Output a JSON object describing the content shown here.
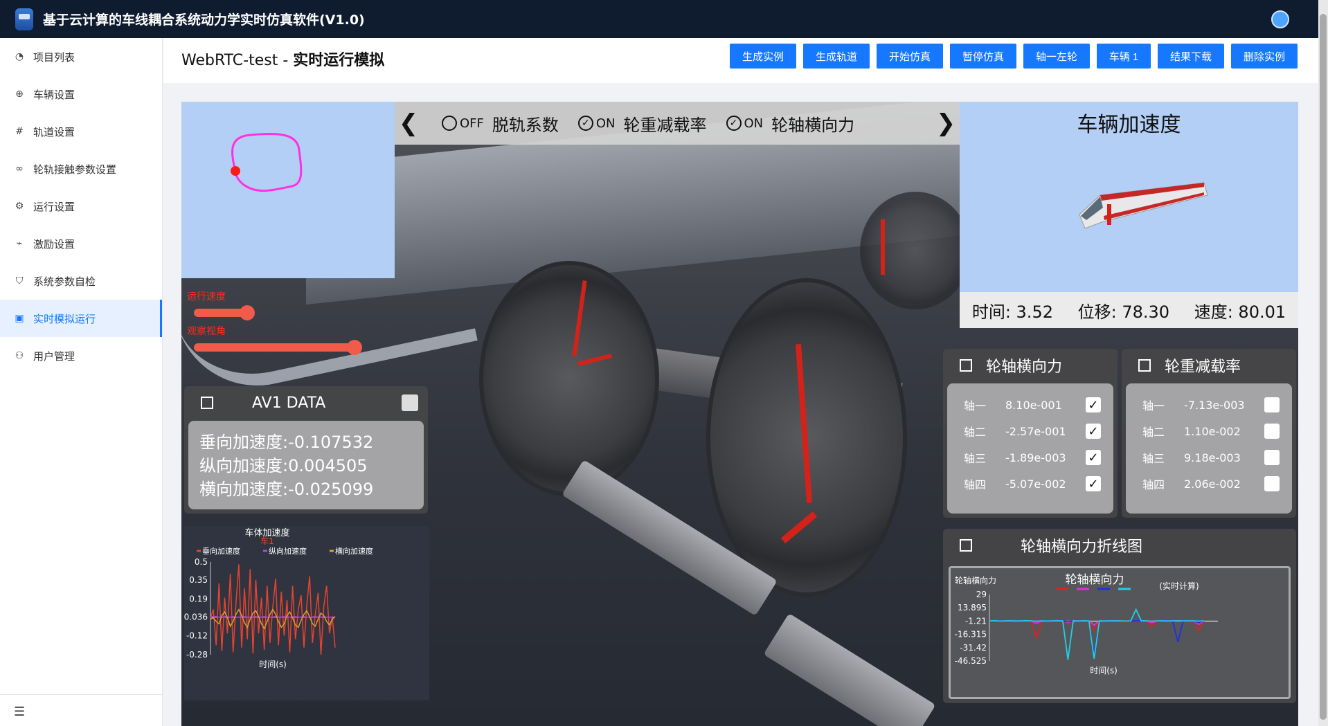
{
  "app": {
    "title": "基于云计算的车线耦合系统动力学实时仿真软件(V1.0)"
  },
  "sidebar": {
    "items": [
      {
        "label": "项目列表",
        "icon": "dashboard-icon"
      },
      {
        "label": "车辆设置",
        "icon": "globe-icon"
      },
      {
        "label": "轨道设置",
        "icon": "hash-icon"
      },
      {
        "label": "轮轨接触参数设置",
        "icon": "link-icon"
      },
      {
        "label": "运行设置",
        "icon": "gear-icon"
      },
      {
        "label": "激励设置",
        "icon": "line-chart-icon"
      },
      {
        "label": "系统参数自检",
        "icon": "shield-check-icon"
      },
      {
        "label": "实时模拟运行",
        "icon": "monitor-icon",
        "active": true
      },
      {
        "label": "用户管理",
        "icon": "user-icon"
      }
    ]
  },
  "header": {
    "project": "WebRTC-test - ",
    "page": "实时运行模拟",
    "buttons": [
      "生成实例",
      "生成轨道",
      "开始仿真",
      "暂停仿真",
      "轴一左轮",
      "车辆 1",
      "结果下载",
      "删除实例"
    ]
  },
  "toggles": [
    {
      "state": "OFF",
      "label": "脱轨系数",
      "checked": false
    },
    {
      "state": "ON",
      "label": "轮重减载率",
      "checked": true
    },
    {
      "state": "ON",
      "label": "轮轴横向力",
      "checked": true
    }
  ],
  "sliders": [
    {
      "label": "运行速度",
      "level": 0.33
    },
    {
      "label": "观察视角",
      "level": 1.0
    }
  ],
  "accel_panel": {
    "title": "车辆加速度"
  },
  "status": {
    "time_label": "时间: 3.52",
    "disp_label": "位移: 78.30",
    "speed_label": "速度: 80.01"
  },
  "av1": {
    "title": "AV1 DATA",
    "lines": [
      "垂向加速度:-0.107532",
      "纵向加速度:0.004505",
      "横向加速度:-0.025099"
    ]
  },
  "axle_force_panel": {
    "title": "轮轴横向力",
    "rows": [
      {
        "k": "轴一",
        "v": "8.10e-001",
        "checked": true
      },
      {
        "k": "轴二",
        "v": "-2.57e-001",
        "checked": true
      },
      {
        "k": "轴三",
        "v": "-1.89e-003",
        "checked": true
      },
      {
        "k": "轴四",
        "v": "-5.07e-002",
        "checked": true
      }
    ]
  },
  "wheel_unload_panel": {
    "title": "轮重减载率",
    "rows": [
      {
        "k": "轴一",
        "v": "-7.13e-003",
        "checked": false
      },
      {
        "k": "轴二",
        "v": "1.10e-002",
        "checked": false
      },
      {
        "k": "轴三",
        "v": "9.18e-003",
        "checked": false
      },
      {
        "k": "轴四",
        "v": "2.06e-002",
        "checked": false
      }
    ]
  },
  "chart_panel_title": "轮轴横向力折线图",
  "chart_data": [
    {
      "type": "line",
      "title": "车体加速度",
      "subtitle": "车1",
      "xlabel": "时间(s)",
      "ylabel": "",
      "yticks": [
        "0.5",
        "0.35",
        "0.19",
        "0.036",
        "-0.12",
        "-0.28"
      ],
      "ylim": [
        -0.28,
        0.5
      ],
      "grid": false,
      "legend": "top",
      "series": [
        {
          "name": "垂向加速度",
          "color": "#e8432e",
          "values": [
            0.03,
            0.1,
            -0.2,
            0.32,
            -0.25,
            0.2,
            -0.1,
            0.4,
            -0.26,
            0.15,
            0.48,
            -0.22,
            0.28,
            -0.15,
            0.44,
            -0.27,
            0.35,
            -0.1,
            0.2,
            -0.24,
            0.3,
            -0.18,
            0.12,
            0.36,
            -0.2,
            0.25,
            -0.12,
            0.18,
            -0.26,
            0.3,
            -0.15,
            0.1,
            0.22,
            -0.22,
            0.14,
            0.38,
            -0.18,
            0.06,
            0.24,
            -0.28,
            0.12,
            0.3,
            -0.1,
            0.04,
            -0.22
          ]
        },
        {
          "name": "纵向加速度",
          "color": "#c040d8",
          "values": [
            0.04,
            0.04,
            0.04,
            0.035,
            0.036,
            0.04,
            0.038,
            0.036,
            0.04,
            0.037,
            0.036,
            0.038,
            0.04,
            0.036,
            0.035,
            0.038,
            0.04,
            0.036,
            0.037,
            0.04,
            0.036,
            0.035,
            0.038,
            0.04,
            0.036,
            0.037,
            0.04,
            0.036,
            0.035,
            0.038,
            0.04,
            0.036,
            0.037,
            0.04,
            0.036,
            0.035,
            0.038,
            0.04,
            0.036,
            0.037,
            0.04,
            0.036,
            0.035,
            0.038,
            0.036
          ]
        },
        {
          "name": "横向加速度",
          "color": "#d9a030",
          "values": [
            0.02,
            0.03,
            0.0,
            -0.02,
            0.05,
            0.08,
            0.03,
            -0.04,
            0.0,
            0.06,
            0.1,
            0.05,
            -0.01,
            -0.05,
            0.02,
            0.07,
            0.09,
            0.04,
            -0.02,
            -0.06,
            0.0,
            0.06,
            0.1,
            0.06,
            0.0,
            -0.05,
            -0.02,
            0.05,
            0.08,
            0.03,
            -0.03,
            -0.05,
            0.01,
            0.06,
            0.09,
            0.04,
            -0.02,
            -0.04,
            0.02,
            0.07,
            0.05,
            0.0,
            -0.03,
            0.02,
            0.04
          ]
        }
      ]
    },
    {
      "type": "line",
      "title": "轮轴横向力",
      "subtitle": "(实时计算)",
      "xlabel": "时间(s)",
      "ylabel": "轮轴横向力",
      "yticks": [
        "29",
        "13.895",
        "-1.21",
        "-16.315",
        "-31.42",
        "-46.525"
      ],
      "ylim": [
        -46.525,
        29
      ],
      "grid": false,
      "legend": "top",
      "series": [
        {
          "name": "",
          "color": "#e02020",
          "values": [
            -1,
            -1.5,
            -1,
            -2,
            -1,
            -0.5,
            -1,
            -1.5,
            -1,
            -20,
            -1,
            -0.5,
            -1,
            -1.5,
            -1,
            -2,
            -1,
            -1,
            -1.5,
            -1,
            -12,
            -1,
            -0.5,
            -1,
            -1.5,
            -1,
            -2,
            -1,
            -1,
            -1.5,
            -1,
            -8,
            -1,
            -1,
            -0.5,
            -1,
            -1.5,
            -1,
            -1,
            -1,
            -12,
            -1
          ]
        },
        {
          "name": "",
          "color": "#e030e0",
          "values": [
            -1,
            -1.2,
            -0.8,
            -1,
            -1.2,
            -0.6,
            -1,
            -1.4,
            -1,
            -4,
            -1,
            -0.8,
            -1,
            -1.2,
            -1,
            -3,
            -1,
            -1.2,
            -0.8,
            -1,
            -6,
            -1,
            -0.8,
            -1,
            -1.2,
            -1,
            -1.5,
            -1,
            -0.8,
            -1,
            -1.2,
            -3,
            -1,
            -1,
            -0.8,
            -1,
            -1.2,
            -1,
            -1,
            -1,
            -5,
            -1
          ]
        },
        {
          "name": "",
          "color": "#2030e0",
          "values": [
            -1,
            -1.1,
            -0.9,
            -1,
            -1.1,
            -0.9,
            -1,
            -1.2,
            -1,
            -2,
            -1,
            -0.9,
            -1,
            -1.1,
            -1,
            -2,
            -1,
            -1.1,
            -0.9,
            -1,
            -40,
            -1,
            -0.9,
            -1,
            -1.1,
            -1,
            -1.5,
            -1,
            -0.9,
            -1,
            -1.1,
            -2,
            -1,
            -1,
            -0.9,
            -1,
            -25,
            -1,
            -1,
            -1,
            -3,
            -1
          ]
        },
        {
          "name": "",
          "color": "#20d0e8",
          "values": [
            -1,
            -0.8,
            -1.2,
            -1,
            -0.9,
            -1.1,
            -1,
            -0.8,
            -1,
            -1.5,
            -1,
            -1.2,
            -1,
            -0.9,
            -1,
            -45,
            -1,
            -1.1,
            -0.9,
            -1,
            -44,
            -1,
            -1.1,
            -1,
            -0.9,
            -1,
            -1.2,
            -1,
            12,
            -1,
            -0.9,
            -1.5,
            -1,
            -1,
            -1.1,
            -1,
            -0.9,
            -1,
            -1,
            -1,
            -1.3,
            -1
          ]
        }
      ]
    }
  ]
}
